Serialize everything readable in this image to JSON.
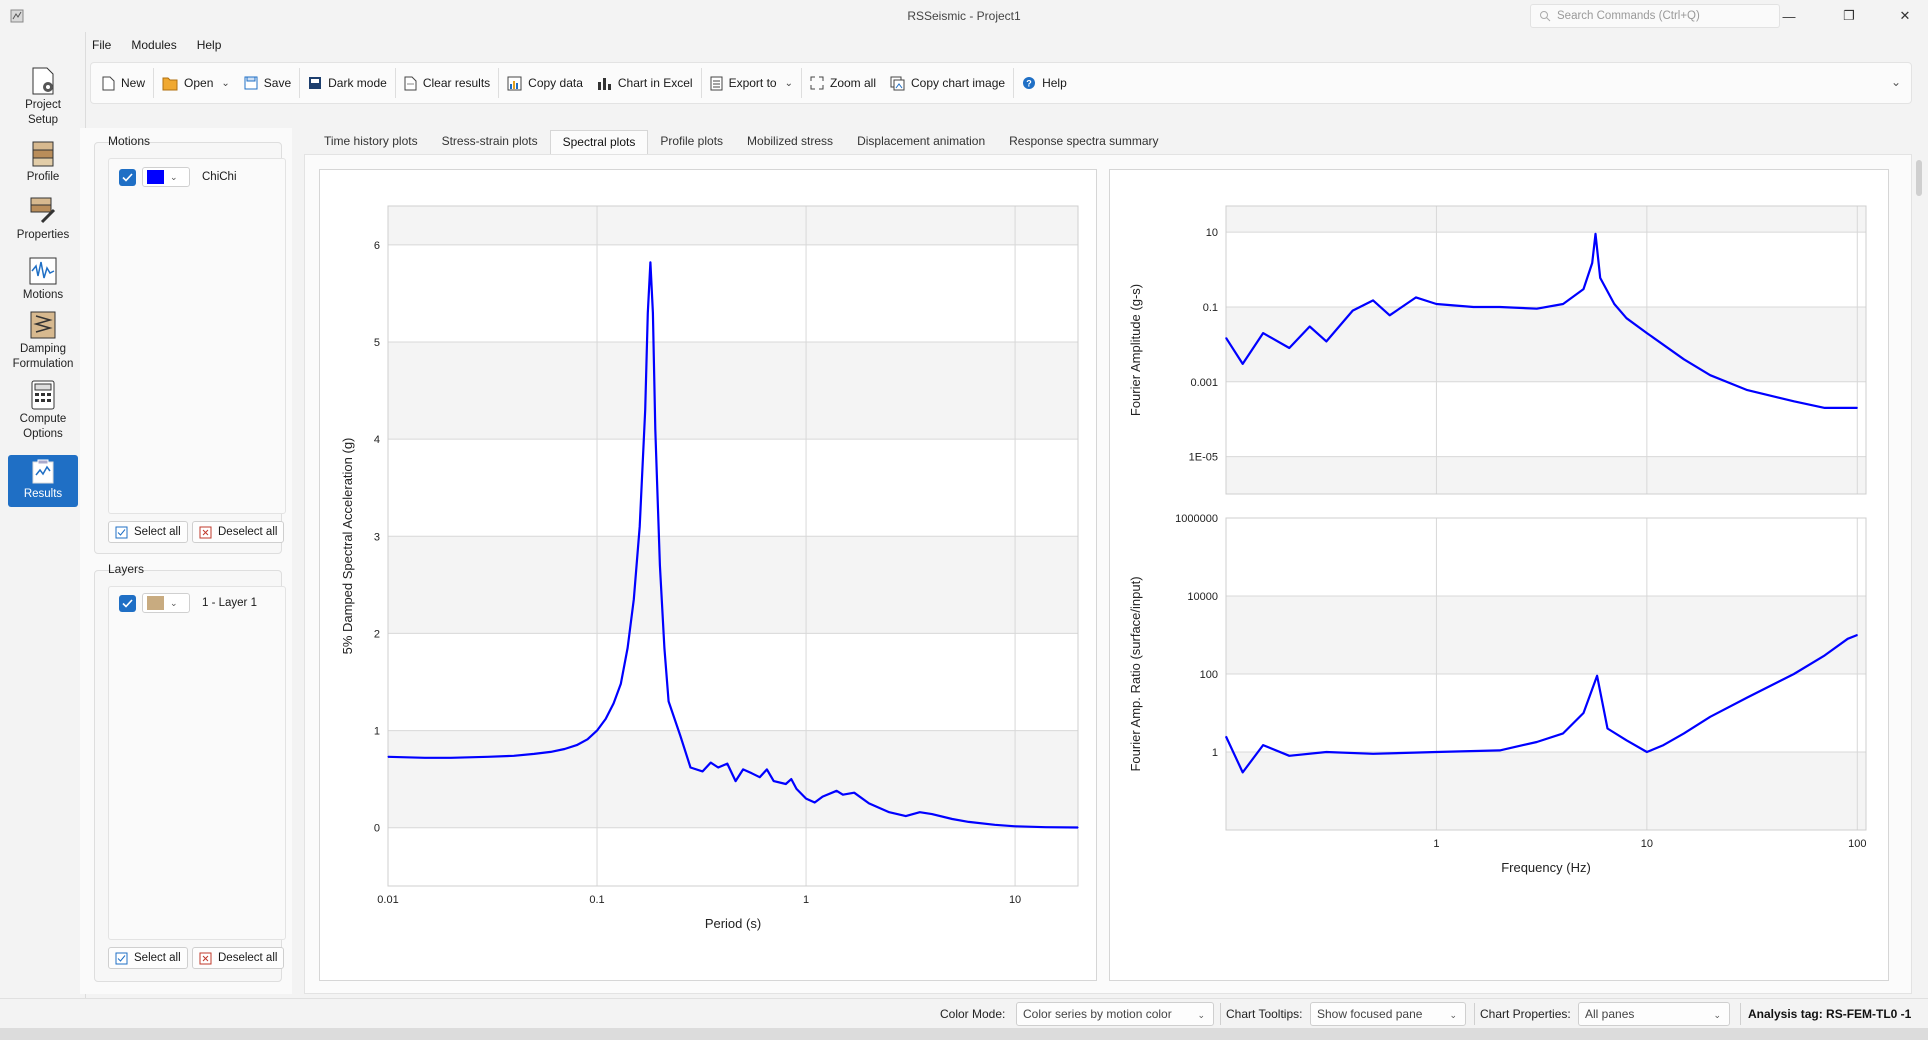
{
  "window": {
    "title": "RSSeismic - Project1",
    "search_placeholder": "Search Commands (Ctrl+Q)"
  },
  "menu": [
    "File",
    "Modules",
    "Help"
  ],
  "nav": {
    "project_setup": [
      "Project",
      "Setup"
    ],
    "profile": "Profile",
    "properties": "Properties",
    "motions": "Motions",
    "damping": [
      "Damping",
      "Formulation"
    ],
    "compute": [
      "Compute",
      "Options"
    ],
    "results": "Results"
  },
  "toolbar": {
    "new": "New",
    "open": "Open",
    "save": "Save",
    "dark_mode": "Dark mode",
    "clear_results": "Clear results",
    "copy_data": "Copy data",
    "chart_in_excel": "Chart in Excel",
    "export_to": "Export to",
    "zoom_all": "Zoom all",
    "copy_chart_image": "Copy chart image",
    "help": "Help"
  },
  "motions_panel": {
    "title": "Motions",
    "items": [
      {
        "label": "ChiChi",
        "color": "#0000ff",
        "checked": true
      }
    ],
    "select_all": "Select all",
    "deselect_all": "Deselect all"
  },
  "layers_panel": {
    "title": "Layers",
    "items": [
      {
        "label": "1 - Layer 1",
        "color": "#c8ab80",
        "checked": true
      }
    ],
    "select_all": "Select all",
    "deselect_all": "Deselect all"
  },
  "tabs": [
    "Time history plots",
    "Stress-strain plots",
    "Spectral plots",
    "Profile plots",
    "Mobilized stress",
    "Displacement animation",
    "Response spectra summary"
  ],
  "active_tab": "Spectral plots",
  "status": {
    "color_mode_label": "Color Mode:",
    "color_mode_value": "Color series by motion color",
    "tooltips_label": "Chart Tooltips:",
    "tooltips_value": "Show focused pane",
    "properties_label": "Chart Properties:",
    "properties_value": "All panes",
    "analysis_tag": "Analysis tag: RS-FEM-TL0 -1"
  },
  "colors": {
    "series": "#0000ff",
    "accent": "#1f6fc5"
  },
  "chart_data": [
    {
      "type": "line",
      "xlabel": "Period (s)",
      "ylabel": "5% Damped Spectral Acceleration (g)",
      "x_scale": "log",
      "xlim": [
        0.01,
        20
      ],
      "ylim": [
        -0.6,
        6.4
      ],
      "x_ticks": [
        "0.01",
        "0.1",
        "1",
        "10"
      ],
      "y_ticks": [
        "0",
        "1",
        "2",
        "3",
        "4",
        "5",
        "6"
      ],
      "series": [
        {
          "points": [
            [
              0.01,
              0.73
            ],
            [
              0.015,
              0.72
            ],
            [
              0.02,
              0.72
            ],
            [
              0.03,
              0.73
            ],
            [
              0.04,
              0.74
            ],
            [
              0.05,
              0.76
            ],
            [
              0.06,
              0.78
            ],
            [
              0.07,
              0.81
            ],
            [
              0.08,
              0.85
            ],
            [
              0.09,
              0.91
            ],
            [
              0.1,
              1.0
            ],
            [
              0.11,
              1.12
            ],
            [
              0.12,
              1.28
            ],
            [
              0.13,
              1.48
            ],
            [
              0.14,
              1.85
            ],
            [
              0.15,
              2.35
            ],
            [
              0.16,
              3.1
            ],
            [
              0.17,
              4.3
            ],
            [
              0.175,
              5.3
            ],
            [
              0.18,
              5.82
            ],
            [
              0.185,
              5.3
            ],
            [
              0.19,
              4.1
            ],
            [
              0.2,
              2.7
            ],
            [
              0.21,
              1.85
            ],
            [
              0.22,
              1.3
            ],
            [
              0.25,
              0.95
            ],
            [
              0.28,
              0.62
            ],
            [
              0.32,
              0.58
            ],
            [
              0.35,
              0.67
            ],
            [
              0.38,
              0.62
            ],
            [
              0.42,
              0.66
            ],
            [
              0.46,
              0.48
            ],
            [
              0.5,
              0.6
            ],
            [
              0.55,
              0.56
            ],
            [
              0.6,
              0.52
            ],
            [
              0.65,
              0.6
            ],
            [
              0.7,
              0.48
            ],
            [
              0.8,
              0.45
            ],
            [
              0.85,
              0.5
            ],
            [
              0.9,
              0.4
            ],
            [
              1.0,
              0.3
            ],
            [
              1.1,
              0.26
            ],
            [
              1.2,
              0.32
            ],
            [
              1.4,
              0.38
            ],
            [
              1.5,
              0.34
            ],
            [
              1.7,
              0.36
            ],
            [
              2.0,
              0.25
            ],
            [
              2.5,
              0.16
            ],
            [
              3.0,
              0.12
            ],
            [
              3.5,
              0.16
            ],
            [
              4,
              0.14
            ],
            [
              5,
              0.09
            ],
            [
              6,
              0.06
            ],
            [
              8,
              0.03
            ],
            [
              10,
              0.015
            ],
            [
              14,
              0.005
            ],
            [
              20,
              0.002
            ]
          ]
        }
      ]
    },
    {
      "type": "line",
      "xlabel": "",
      "ylabel": "Fourier Amplitude (g-s)",
      "x_scale": "log",
      "y_scale": "log",
      "xlim": [
        0.1,
        110
      ],
      "ylim": [
        1e-06,
        50
      ],
      "y_ticks": [
        "10",
        "0.1",
        "0.001",
        "1E-05"
      ],
      "series": [
        {
          "points": [
            [
              0.1,
              0.015
            ],
            [
              0.12,
              0.003
            ],
            [
              0.15,
              0.02
            ],
            [
              0.2,
              0.008
            ],
            [
              0.25,
              0.03
            ],
            [
              0.3,
              0.012
            ],
            [
              0.4,
              0.08
            ],
            [
              0.5,
              0.15
            ],
            [
              0.6,
              0.06
            ],
            [
              0.8,
              0.18
            ],
            [
              1.0,
              0.12
            ],
            [
              1.5,
              0.1
            ],
            [
              2,
              0.1
            ],
            [
              3,
              0.09
            ],
            [
              4,
              0.12
            ],
            [
              5,
              0.3
            ],
            [
              5.5,
              1.5
            ],
            [
              5.7,
              9
            ],
            [
              6,
              0.6
            ],
            [
              7,
              0.12
            ],
            [
              8,
              0.05
            ],
            [
              10,
              0.02
            ],
            [
              15,
              0.004
            ],
            [
              20,
              0.0015
            ],
            [
              30,
              0.0006
            ],
            [
              50,
              0.0003
            ],
            [
              70,
              0.0002
            ],
            [
              100,
              0.0002
            ]
          ]
        }
      ]
    },
    {
      "type": "line",
      "xlabel": "Frequency (Hz)",
      "ylabel": "Fourier Amp. Ratio (surface/input)",
      "x_scale": "log",
      "y_scale": "log",
      "xlim": [
        0.1,
        110
      ],
      "ylim": [
        0.01,
        1000000
      ],
      "x_ticks": [
        "1",
        "10",
        "100"
      ],
      "y_ticks": [
        "1000000",
        "10000",
        "100",
        "1"
      ],
      "series": [
        {
          "points": [
            [
              0.1,
              2.5
            ],
            [
              0.12,
              0.3
            ],
            [
              0.15,
              1.5
            ],
            [
              0.2,
              0.8
            ],
            [
              0.3,
              1.0
            ],
            [
              0.5,
              0.9
            ],
            [
              1,
              1.0
            ],
            [
              2,
              1.1
            ],
            [
              3,
              1.8
            ],
            [
              4,
              3
            ],
            [
              5,
              10
            ],
            [
              5.8,
              90
            ],
            [
              6.5,
              4
            ],
            [
              8,
              2
            ],
            [
              10,
              1
            ],
            [
              12,
              1.5
            ],
            [
              15,
              3
            ],
            [
              20,
              8
            ],
            [
              30,
              25
            ],
            [
              50,
              100
            ],
            [
              70,
              300
            ],
            [
              90,
              800
            ],
            [
              100,
              1000
            ]
          ]
        }
      ]
    }
  ]
}
